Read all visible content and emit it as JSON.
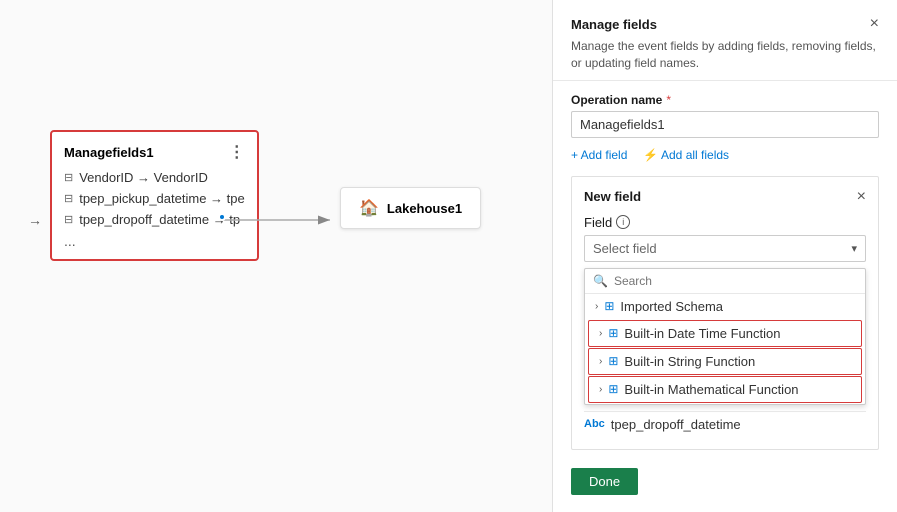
{
  "panel": {
    "title": "Manage fields",
    "description": "Manage the event fields by adding fields, removing fields, or updating field names.",
    "close_label": "×",
    "op_label": "Operation name",
    "op_required": "*",
    "op_value": "Managefields1",
    "add_field_label": "+ Add field",
    "add_all_fields_label": "⚡ Add all fields",
    "new_field_title": "New field",
    "field_info_label": "Field",
    "select_placeholder": "Select field",
    "search_placeholder": "Search",
    "dropdown_items": [
      {
        "id": "imported-schema",
        "label": "Imported Schema",
        "highlighted": false
      },
      {
        "id": "datetime-func",
        "label": "Built-in Date Time Function",
        "highlighted": true
      },
      {
        "id": "string-func",
        "label": "Built-in String Function",
        "highlighted": true
      },
      {
        "id": "math-func",
        "label": "Built-in Mathematical Function",
        "highlighted": true
      }
    ],
    "preview_field": "tpep_dropoff_datetime",
    "done_label": "Done"
  },
  "canvas": {
    "manage_node_title": "Managefields1",
    "fields": [
      {
        "label": "VendorID → VendorID"
      },
      {
        "label": "tpep_pickup_datetime → tpe"
      },
      {
        "label": "tpep_dropoff_datetime → tp"
      }
    ],
    "more_label": "...",
    "lakehouse_label": "Lakehouse1"
  },
  "icons": {
    "close": "×",
    "chevron_down": "▾",
    "chevron_right": "›",
    "search": "🔍",
    "grid": "⊞",
    "abc": "Abc",
    "info": "i",
    "ellipsis": "⋮",
    "lightning": "⚡",
    "lakehouse": "🏠"
  }
}
